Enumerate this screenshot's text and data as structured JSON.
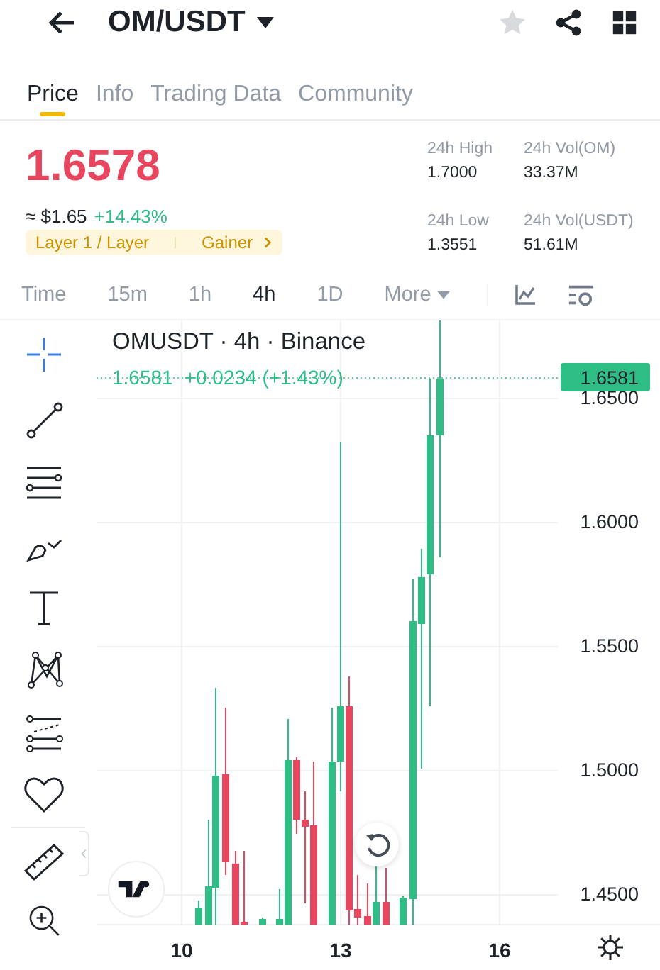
{
  "header": {
    "pair": "OM/USDT",
    "favorited": false
  },
  "tabs": [
    {
      "label": "Price",
      "selected": true
    },
    {
      "label": "Info",
      "selected": false
    },
    {
      "label": "Trading Data",
      "selected": false
    },
    {
      "label": "Community",
      "selected": false
    }
  ],
  "price": {
    "last": "1.6578",
    "approx": "≈ $1.65",
    "change": "+14.43%",
    "tags": [
      "Layer 1 / Layer",
      "Gainer"
    ]
  },
  "stats": [
    {
      "label": "24h High",
      "value": "1.7000"
    },
    {
      "label": "24h Vol(OM)",
      "value": "33.37M"
    },
    {
      "label": "24h Low",
      "value": "1.3551"
    },
    {
      "label": "24h Vol(USDT)",
      "value": "51.61M"
    }
  ],
  "intervals": [
    {
      "label": "Time",
      "selected": false
    },
    {
      "label": "15m",
      "selected": false
    },
    {
      "label": "1h",
      "selected": false
    },
    {
      "label": "4h",
      "selected": true
    },
    {
      "label": "1D",
      "selected": false
    }
  ],
  "more_label": "More",
  "chart": {
    "title": "OMUSDT · 4h · Binance",
    "last": "1.6581",
    "change": "+0.0234 (+1.43%)",
    "price_tag": "1.6581",
    "y_ticks": [
      "1.6500",
      "1.6000",
      "1.5500",
      "1.5000",
      "1.4500"
    ],
    "x_ticks": [
      "10",
      "13",
      "16"
    ]
  }
}
